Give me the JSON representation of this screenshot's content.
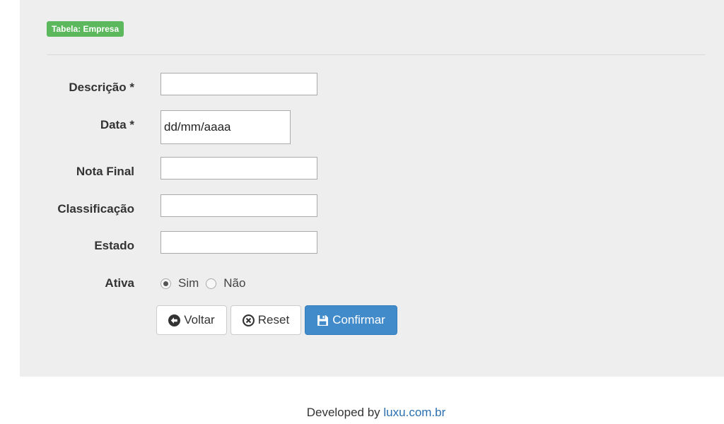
{
  "badge": "Tabela: Empresa",
  "form": {
    "descricao_label": "Descrição *",
    "descricao_value": "",
    "data_label": "Data *",
    "data_value": "dd/mm/aaaa",
    "nota_label": "Nota Final",
    "nota_value": "",
    "classificacao_label": "Classificação",
    "classificacao_value": "",
    "estado_label": "Estado",
    "estado_value": "",
    "ativa_label": "Ativa",
    "ativa_options": [
      "Sim",
      "Não"
    ],
    "ativa_selected": "Sim"
  },
  "buttons": {
    "voltar": "Voltar",
    "reset": "Reset",
    "confirmar": "Confirmar"
  },
  "footer": {
    "text": "Developed by ",
    "link": "luxu.com.br"
  },
  "colors": {
    "badge": "#5cb85c",
    "primary": "#428bca",
    "panel": "#eeeeee",
    "link": "#2a6fb0"
  },
  "icons": {
    "voltar": "arrow-circle-left-icon",
    "reset": "remove-circle-icon",
    "confirmar": "floppy-disk-icon"
  }
}
